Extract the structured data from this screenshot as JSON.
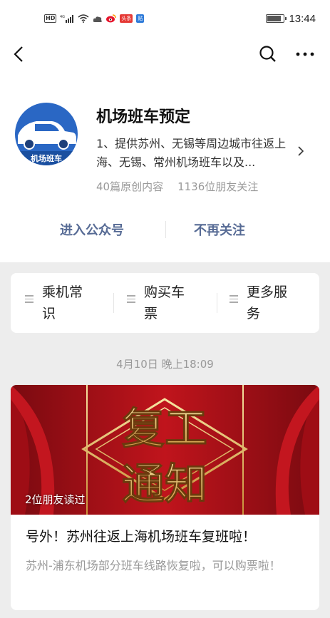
{
  "status_bar": {
    "left_badges": [
      "HD",
      "4G"
    ],
    "app_badge_1": "头条",
    "app_badge_2": "贴",
    "time": "13:44",
    "battery_level": 0.85
  },
  "nav": {
    "back_icon": "chevron-left-icon",
    "search_icon": "search-icon",
    "more_icon": "more-horizontal-icon"
  },
  "account": {
    "avatar_text": "机场班车",
    "name": "机场班车预定",
    "description": "1、提供苏州、无锡等周边城市往返上海、无锡、常州机场班车以及...",
    "original_count": "40篇原创内容",
    "friends_following": "1136位朋友关注",
    "enter_label": "进入公众号",
    "unfollow_label": "不再关注"
  },
  "menu": [
    {
      "line1": "乘机常",
      "line2": "识"
    },
    {
      "line1": "购买车",
      "line2": "票"
    },
    {
      "line1": "更多服",
      "line2": "务"
    }
  ],
  "feed": {
    "date": "4月10日 晚上18:09",
    "article": {
      "cover_text_1": "复工",
      "cover_text_2": "通知",
      "friends_read": "2位朋友读过",
      "title": "号外！苏州往返上海机场班车复班啦！",
      "digest": "苏州-浦东机场部分班车线路恢复啦，可以购票啦！"
    }
  },
  "colors": {
    "link_blue": "#576b95",
    "cover_red": "#b3121b",
    "gold": "#e8c36a"
  }
}
